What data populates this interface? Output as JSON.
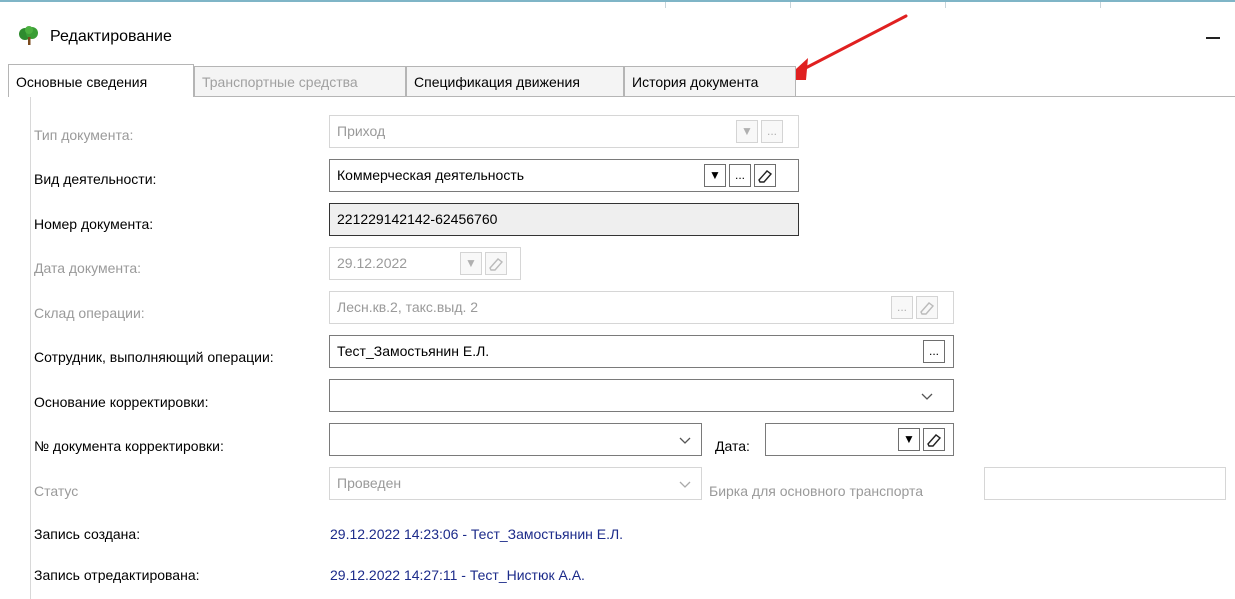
{
  "window": {
    "title": "Редактирование"
  },
  "tabs": [
    {
      "label": "Основные сведения",
      "state": "active"
    },
    {
      "label": "Транспортные средства",
      "state": "disabled"
    },
    {
      "label": "Спецификация движения",
      "state": "normal"
    },
    {
      "label": "История документа",
      "state": "normal"
    }
  ],
  "form": {
    "doc_type": {
      "label": "Тип документа:",
      "value": "Приход",
      "disabled": true
    },
    "activity": {
      "label": "Вид деятельности:",
      "value": "Коммерческая деятельность"
    },
    "doc_number": {
      "label": "Номер документа:",
      "value": "221229142142-62456760"
    },
    "doc_date": {
      "label": "Дата документа:",
      "value": "29.12.2022",
      "disabled": true
    },
    "warehouse": {
      "label": "Склад операции:",
      "value": "Лесн.кв.2, такс.выд. 2",
      "disabled": true
    },
    "employee": {
      "label": "Сотрудник, выполняющий операции:",
      "value": "Тест_Замостьянин Е.Л."
    },
    "correction_reason": {
      "label": "Основание корректировки:",
      "value": ""
    },
    "correction_doc_number": {
      "label": "№ документа корректировки:",
      "value": ""
    },
    "correction_date": {
      "label": "Дата:",
      "value": ""
    },
    "status": {
      "label": "Статус",
      "value": "Проведен",
      "disabled": true
    },
    "tag": {
      "label": "Бирка для основного транспорта",
      "value": ""
    },
    "created": {
      "label": "Запись создана:",
      "value": "29.12.2022 14:23:06 - Тест_Замостьянин Е.Л."
    },
    "edited": {
      "label": "Запись отредактирована:",
      "value": "29.12.2022 14:27:11 - Тест_Нистюк А.А."
    }
  },
  "buttons": {
    "ellipsis": "...",
    "dropdown": "▼"
  },
  "colors": {
    "link_text": "#1c2b8a",
    "disabled_text": "#9a9a9a",
    "annotation_arrow": "#e02020",
    "app_icon": "#2e8b2e"
  }
}
